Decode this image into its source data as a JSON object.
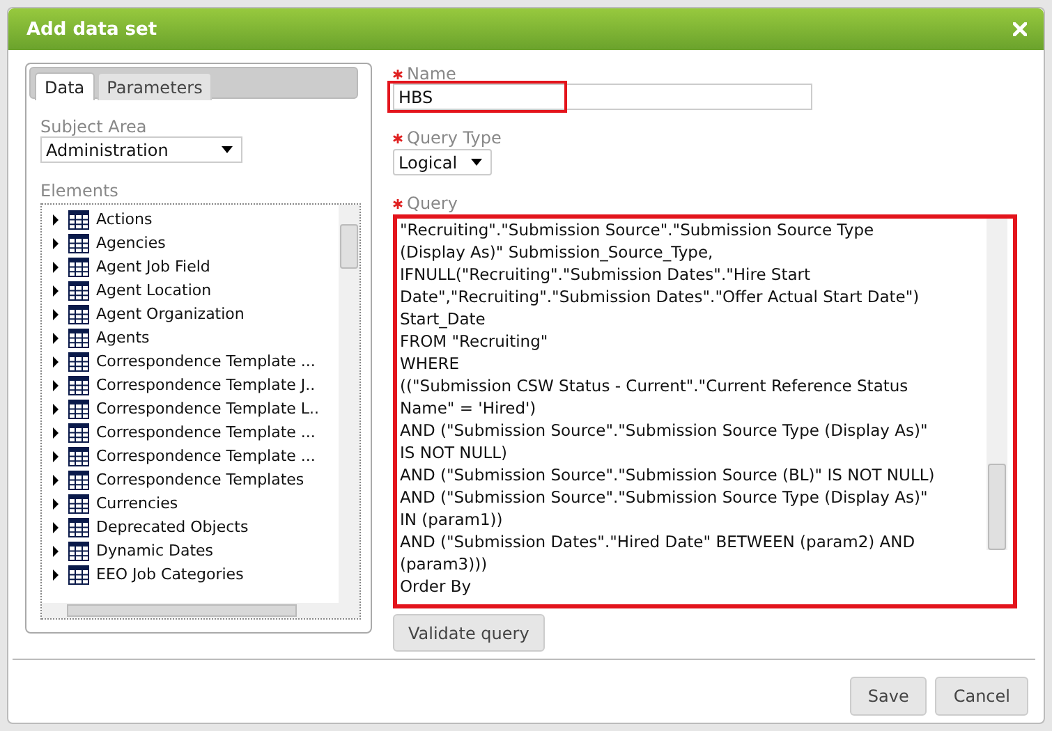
{
  "dialog": {
    "title": "Add data set"
  },
  "tabs": [
    {
      "label": "Data",
      "selected": true
    },
    {
      "label": "Parameters",
      "selected": false
    }
  ],
  "subject_area": {
    "label": "Subject Area",
    "value": "Administration"
  },
  "elements": {
    "label": "Elements",
    "items": [
      {
        "name": "Actions"
      },
      {
        "name": "Agencies"
      },
      {
        "name": "Agent Job Field"
      },
      {
        "name": "Agent Location"
      },
      {
        "name": "Agent Organization"
      },
      {
        "name": "Agents"
      },
      {
        "name": "Correspondence Template ..."
      },
      {
        "name": "Correspondence Template J.."
      },
      {
        "name": "Correspondence Template L.."
      },
      {
        "name": "Correspondence Template ..."
      },
      {
        "name": "Correspondence Template ..."
      },
      {
        "name": "Correspondence Templates"
      },
      {
        "name": "Currencies"
      },
      {
        "name": "Deprecated Objects"
      },
      {
        "name": "Dynamic Dates"
      },
      {
        "name": "EEO Job Categories"
      }
    ]
  },
  "name_field": {
    "label": "Name",
    "required": true,
    "value": "HBS",
    "highlighted": true
  },
  "query_type": {
    "label": "Query Type",
    "required": true,
    "value": "Logical"
  },
  "query": {
    "label": "Query",
    "required": true,
    "highlighted": true,
    "lines": [
      "\"Recruiting\".\"Submission Source\".\"Submission Source Type",
      "(Display As)\" Submission_Source_Type,",
      "IFNULL(\"Recruiting\".\"Submission Dates\".\"Hire Start",
      "Date\",\"Recruiting\".\"Submission Dates\".\"Offer Actual Start Date\")",
      "Start_Date",
      "FROM \"Recruiting\"",
      "WHERE",
      "((\"Submission CSW Status - Current\".\"Current Reference Status",
      "Name\" = 'Hired')",
      "AND (\"Submission Source\".\"Submission Source Type (Display As)\"",
      "IS NOT NULL)",
      "AND (\"Submission Source\".\"Submission Source (BL)\" IS NOT NULL)",
      "AND (\"Submission Source\".\"Submission Source Type (Display As)\"",
      "IN (param1))",
      "AND (\"Submission Dates\".\"Hired Date\" BETWEEN (param2) AND",
      "(param3)))",
      "Order By"
    ]
  },
  "validate_button": "Validate query",
  "buttons": [
    {
      "label": "Save"
    },
    {
      "label": "Cancel"
    }
  ]
}
